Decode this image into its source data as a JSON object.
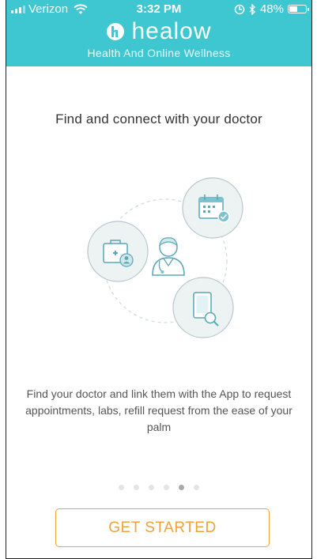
{
  "status_bar": {
    "carrier": "Verizon",
    "time": "3:32 PM",
    "battery_percent_text": "48%",
    "battery_level": 0.48,
    "icons": [
      "signal-icon",
      "wifi-icon",
      "location-icon",
      "bluetooth-icon",
      "battery-icon"
    ]
  },
  "header": {
    "brand_name": "healow",
    "tagline": "Health And Online Wellness",
    "background_color": "#3ec6d1"
  },
  "onboarding": {
    "heading": "Find and connect with your doctor",
    "description": "Find your doctor and link them with the App to request appointments, labs, refill request from the ease of your palm",
    "illustration_icons": [
      "doctor-icon",
      "calendar-check-icon",
      "medical-kit-user-icon",
      "tablet-search-icon"
    ],
    "page_indicator": {
      "total": 6,
      "active_index": 4
    }
  },
  "actions": {
    "get_started_label": "GET STARTED",
    "accent_color": "#f0a23c"
  }
}
